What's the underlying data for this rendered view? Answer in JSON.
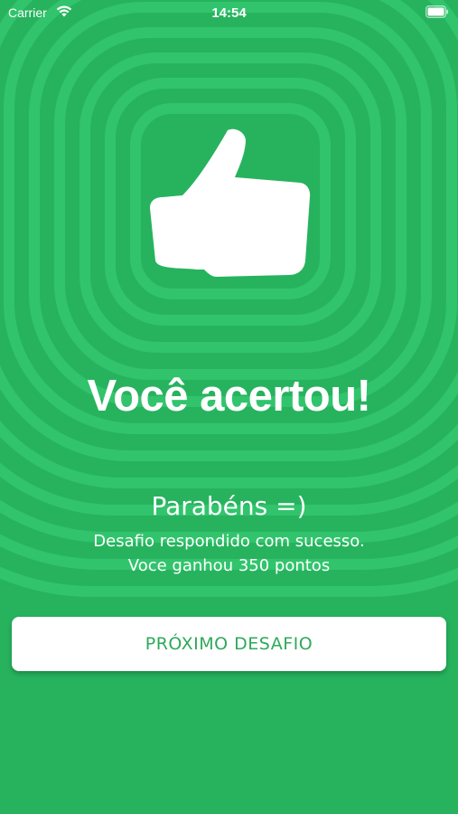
{
  "status_bar": {
    "carrier": "Carrier",
    "time": "14:54",
    "wifi_icon": "wifi-icon",
    "battery_icon": "battery-icon"
  },
  "result": {
    "icon": "thumbs-up-icon",
    "headline": "Você acertou!",
    "subtitle": "Parabéns =)",
    "message_line1": "Desafio respondido com sucesso.",
    "message_line2": "Voce ganhou 350 pontos"
  },
  "actions": {
    "next_label": "PRÓXIMO DESAFIO"
  },
  "colors": {
    "background": "#27b35e",
    "ring_light": "#2fc46a",
    "button_text": "#2ea95a",
    "text": "#ffffff"
  }
}
